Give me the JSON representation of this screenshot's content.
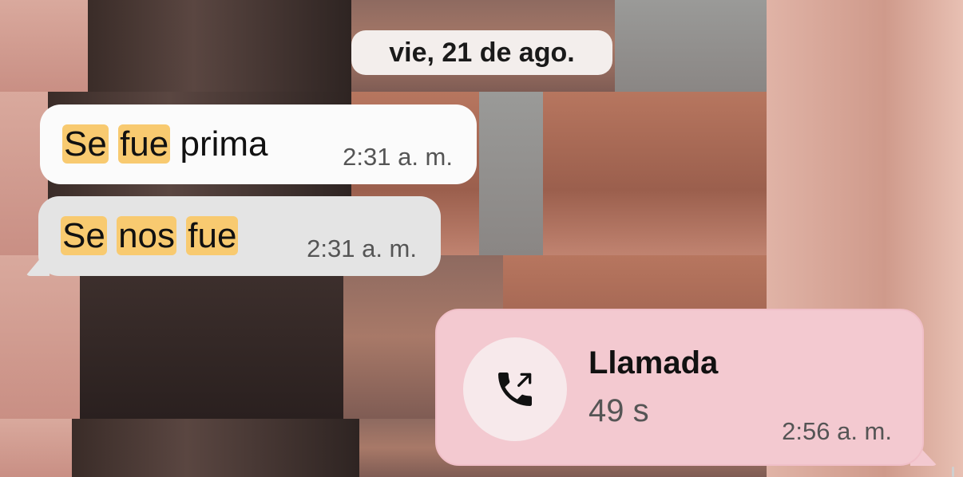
{
  "date_separator": "vie, 21 de ago.",
  "messages": [
    {
      "direction": "incoming",
      "words": [
        "Se",
        "fue",
        "prima"
      ],
      "highlighted_words": [
        "Se",
        "fue"
      ],
      "time": "2:31 a. m."
    },
    {
      "direction": "incoming",
      "words": [
        "Se",
        "nos",
        "fue"
      ],
      "highlighted_words": [
        "Se",
        "nos",
        "fue"
      ],
      "time": "2:31 a. m."
    },
    {
      "direction": "outgoing",
      "type": "call",
      "call_title": "Llamada",
      "call_duration": "49 s",
      "time": "2:56 a. m.",
      "icon": "outgoing-call-icon"
    }
  ],
  "colors": {
    "incoming_bubble_1": "#fbfbfb",
    "incoming_bubble_2": "#e4e4e4",
    "outgoing_bubble": "#f3c9d0",
    "highlight": "#f8ca70",
    "date_chip": "#f3eeec"
  }
}
